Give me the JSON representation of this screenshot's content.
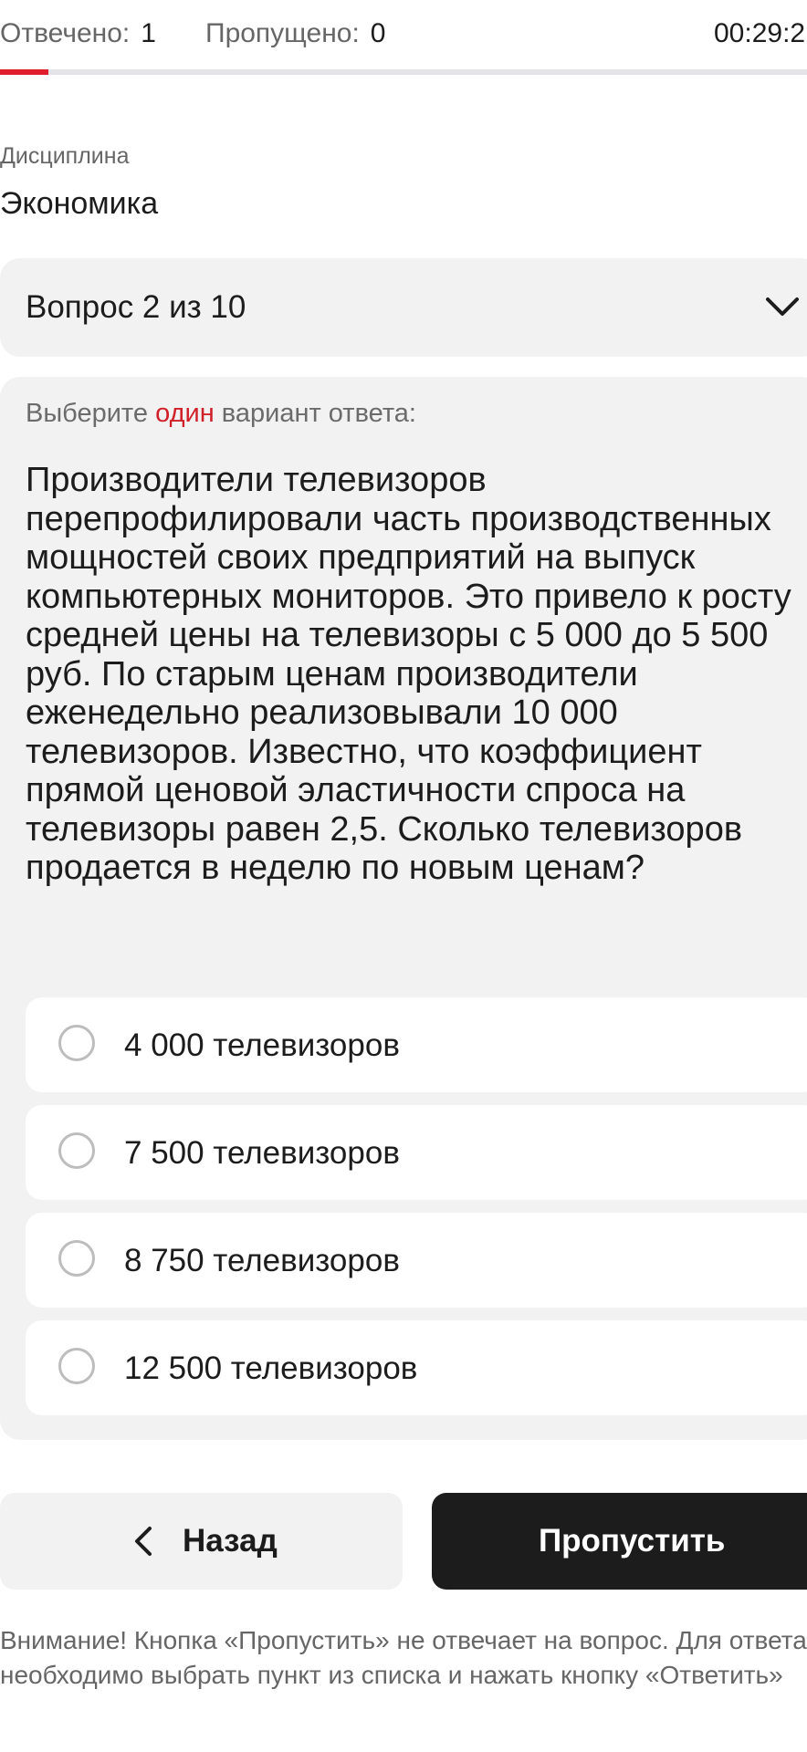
{
  "status": {
    "answered_label": "Отвечено:",
    "answered_value": "1",
    "skipped_label": "Пропущено:",
    "skipped_value": "0",
    "timer": "00:29:2",
    "progress_fraction": 0.06
  },
  "discipline": {
    "label": "Дисциплина",
    "value": "Экономика"
  },
  "question_selector": {
    "text": "Вопрос 2 из 10",
    "icon": "chevron-down-icon"
  },
  "question": {
    "instruction_prefix": "Выберите",
    "instruction_accent": "один",
    "instruction_suffix": "вариант ответа:",
    "text": "Производители телевизоров перепрофилировали часть производственных мощностей своих предприятий на выпуск компьютерных мониторов. Это привело к росту средней цены на телевизоры с 5 000 до 5 500 руб. По старым ценам производители еженедельно реализовывали 10 000 телевизоров. Известно, что коэффициент прямой ценовой эластичности спроса на телевизоры равен 2,5. Сколько телевизоров продается в неделю по новым ценам?",
    "options": [
      {
        "label": "4 000 телевизоров"
      },
      {
        "label": "7 500 телевизоров"
      },
      {
        "label": "8 750 телевизоров"
      },
      {
        "label": "12 500 телевизоров"
      }
    ]
  },
  "buttons": {
    "back": "Назад",
    "skip": "Пропустить"
  },
  "notice": "Внимание! Кнопка «Пропустить» не отвечает на вопрос. Для ответа необходимо выбрать пункт из списка и нажать кнопку «Ответить»",
  "colors": {
    "accent": "#e01e2c",
    "card_bg": "#f2f2f2",
    "primary_button": "#1c1c1c"
  }
}
